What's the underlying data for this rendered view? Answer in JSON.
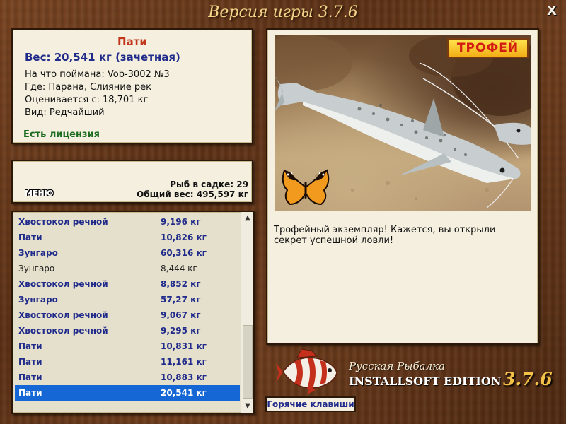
{
  "window": {
    "title": "Версия игры 3.7.6",
    "close_label": "X"
  },
  "fish_info": {
    "name": "Пати",
    "weight": "Вес: 20,541 кг (зачетная)",
    "caught_on": "На что поймана: Vob-3002 №3",
    "location": "Где: Парана, Слияние рек",
    "rated_from": "Оценивается с: 18,701 кг",
    "rarity": "Вид: Редчайший",
    "license": "Есть лицензия"
  },
  "creel": {
    "menu_label": "МЕНЮ",
    "count": "Рыб в садке: 29",
    "total_weight": "Общий вес: 495,597 кг"
  },
  "catch_list": [
    {
      "name": "Хвостокол речной",
      "weight": "9,196 кг",
      "style": "bold"
    },
    {
      "name": "Пати",
      "weight": "10,826 кг",
      "style": "bold"
    },
    {
      "name": "Зунгаро",
      "weight": "60,316 кг",
      "style": "bold"
    },
    {
      "name": "Зунгаро",
      "weight": "8,444 кг",
      "style": "dim"
    },
    {
      "name": "Хвостокол речной",
      "weight": "8,852 кг",
      "style": "bold"
    },
    {
      "name": "Зунгаро",
      "weight": "57,27 кг",
      "style": "bold"
    },
    {
      "name": "Хвостокол речной",
      "weight": "9,067 кг",
      "style": "bold"
    },
    {
      "name": "Хвостокол речной",
      "weight": "9,295 кг",
      "style": "bold"
    },
    {
      "name": "Пати",
      "weight": "10,831 кг",
      "style": "bold"
    },
    {
      "name": "Пати",
      "weight": "11,161 кг",
      "style": "bold"
    },
    {
      "name": "Пати",
      "weight": "10,883 кг",
      "style": "bold"
    },
    {
      "name": "Пати",
      "weight": "20,541 кг",
      "style": "selected"
    }
  ],
  "trophy": {
    "badge": "ТРОФЕЙ",
    "message": "Трофейный экземпляр! Кажется, вы открыли секрет успешной ловли!"
  },
  "brand": {
    "line1": "Русская Рыбалка",
    "line2": "INSTALLSOFT EDITION",
    "version": "3.7.6"
  },
  "hotkeys_label": "Горячие клавиши",
  "icons": {
    "close": "close-icon",
    "scroll_up": "arrow-up-icon",
    "scroll_down": "arrow-down-icon"
  }
}
